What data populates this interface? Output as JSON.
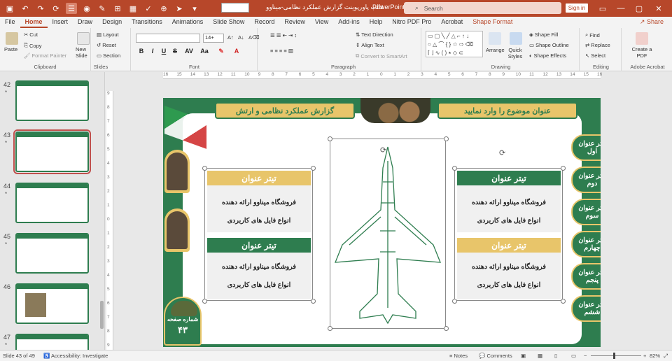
{
  "titlebar": {
    "doc_title": "قالب پاورپوینت گزارش عملکرد نظامی-میناوو",
    "app_name": "PowerPoint",
    "search_placeholder": "Search",
    "sign_in": "Sign in"
  },
  "tabs": [
    "File",
    "Home",
    "Insert",
    "Draw",
    "Design",
    "Transitions",
    "Animations",
    "Slide Show",
    "Record",
    "Review",
    "View",
    "Add-ins",
    "Help",
    "Nitro PDF Pro",
    "Acrobat",
    "Shape Format"
  ],
  "active_tab": "Home",
  "share_label": "Share",
  "ribbon": {
    "clipboard": {
      "paste": "Paste",
      "cut": "Cut",
      "copy": "Copy",
      "format_painter": "Format Painter",
      "label": "Clipboard"
    },
    "slides": {
      "new_slide": "New Slide",
      "layout": "Layout",
      "reset": "Reset",
      "section": "Section",
      "label": "Slides"
    },
    "font": {
      "size": "14+",
      "bold": "B",
      "italic": "I",
      "underline": "U",
      "strike": "S",
      "label": "Font"
    },
    "paragraph": {
      "text_direction": "Text Direction",
      "align_text": "Align Text",
      "smartart": "Convert to SmartArt",
      "label": "Paragraph"
    },
    "drawing": {
      "arrange": "Arrange",
      "quick_styles": "Quick Styles",
      "shape_fill": "Shape Fill",
      "shape_outline": "Shape Outline",
      "shape_effects": "Shape Effects",
      "label": "Drawing"
    },
    "editing": {
      "find": "Find",
      "replace": "Replace",
      "select": "Select",
      "label": "Editing"
    },
    "acrobat": {
      "create_pdf": "Create a PDF",
      "label": "Adobe Acrobat"
    }
  },
  "thumbnails": [
    {
      "num": "42",
      "star": "*"
    },
    {
      "num": "43",
      "star": "*"
    },
    {
      "num": "44",
      "star": "*"
    },
    {
      "num": "45",
      "star": "*"
    },
    {
      "num": "46",
      "star": ""
    },
    {
      "num": "47",
      "star": "*"
    }
  ],
  "ruler": {
    "h": [
      "16",
      "15",
      "14",
      "13",
      "12",
      "11",
      "10",
      "9",
      "8",
      "7",
      "6",
      "5",
      "4",
      "3",
      "2",
      "1",
      "0",
      "1",
      "2",
      "3",
      "4",
      "5",
      "6",
      "7",
      "8",
      "9",
      "10",
      "11",
      "12",
      "13",
      "14",
      "15",
      "16"
    ],
    "v": [
      "9",
      "8",
      "7",
      "6",
      "5",
      "4",
      "3",
      "2",
      "1",
      "0",
      "1",
      "2",
      "3",
      "4",
      "5",
      "6",
      "7",
      "8",
      "9"
    ]
  },
  "slide": {
    "banner_right": "عنوان موضوع را وارد نمایید",
    "banner_left": "گزارش عملکرد نظامی و ارتش",
    "cards": [
      {
        "title": "تیتر عنوان",
        "line1": "فروشگاه میناوو ارائه دهنده",
        "line2": "انواع فایل های کاربردی"
      },
      {
        "title": "تیتر عنوان",
        "line1": "فروشگاه میناوو ارائه دهنده",
        "line2": "انواع فایل های کاربردی"
      },
      {
        "title": "تیتر عنوان",
        "line1": "فروشگاه میناوو ارائه دهنده",
        "line2": "انواع فایل های کاربردی"
      },
      {
        "title": "تیتر عنوان",
        "line1": "فروشگاه میناوو ارائه دهنده",
        "line2": "انواع فایل های کاربردی"
      }
    ],
    "side_items": [
      "تیتر عنوان اول",
      "تیتر عنوان دوم",
      "تیتر عنوان سوم",
      "تیتر عنوان چهارم",
      "تیتر عنوان پنجم",
      "تیتر عنوان ششم"
    ],
    "page_label": "شماره صفحه",
    "page_number": "۴۳"
  },
  "status": {
    "slide_pos": "Slide 43 of 49",
    "accessibility": "Accessibility: Investigate",
    "notes": "Notes",
    "comments": "Comments",
    "zoom": "82%"
  },
  "colors": {
    "accent": "#b7472a",
    "green": "#2e7d4f",
    "gold": "#e8c56a"
  }
}
